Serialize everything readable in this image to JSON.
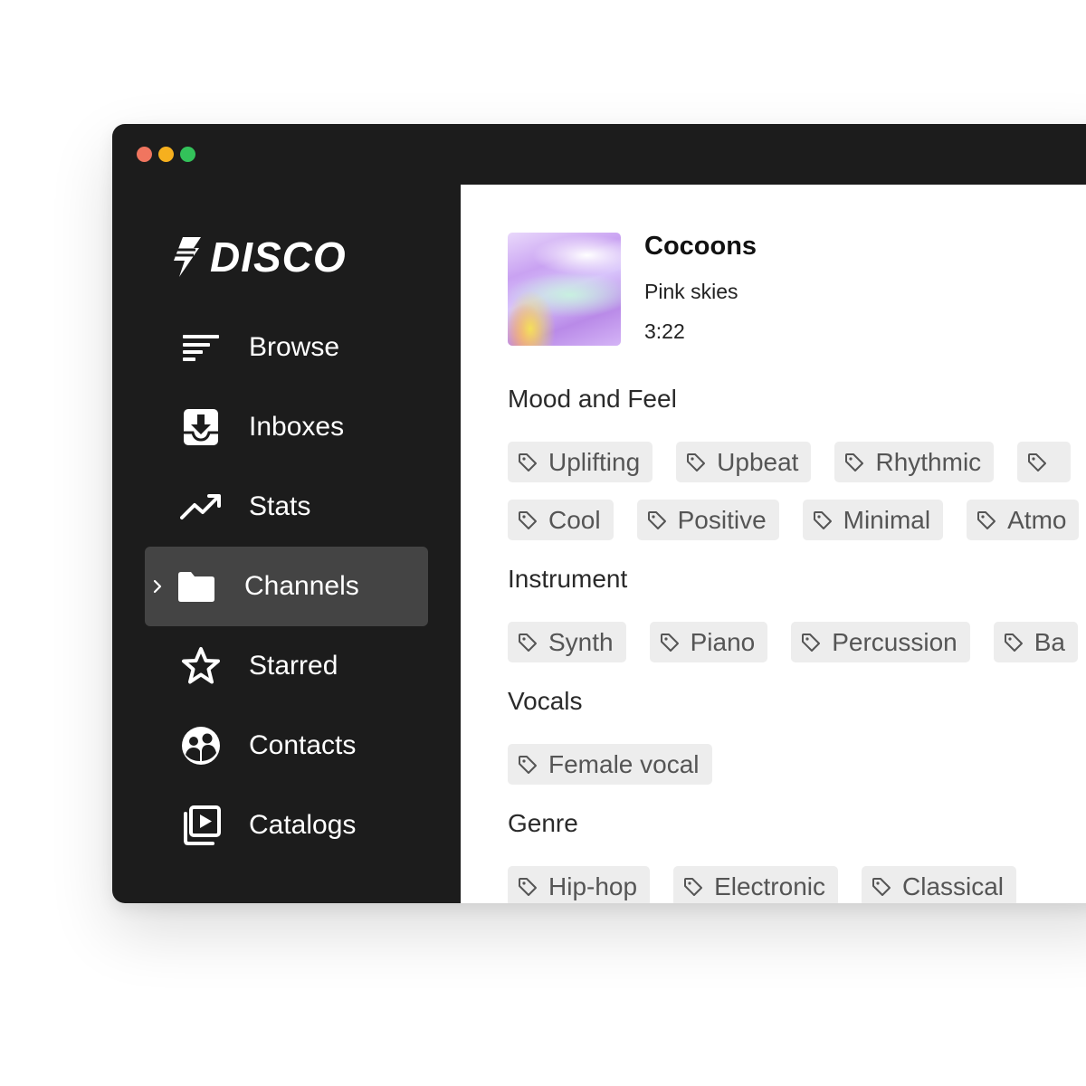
{
  "window": {
    "controls": [
      "close",
      "minimize",
      "maximize"
    ]
  },
  "brand": {
    "name": "DISCO",
    "icon": "lightning-bolt-icon"
  },
  "sidebar": {
    "items": [
      {
        "label": "Browse",
        "icon": "browse-lines-icon",
        "active": false
      },
      {
        "label": "Inboxes",
        "icon": "inbox-download-icon",
        "active": false
      },
      {
        "label": "Stats",
        "icon": "trend-up-icon",
        "active": false
      },
      {
        "label": "Channels",
        "icon": "folder-icon",
        "active": true
      },
      {
        "label": "Starred",
        "icon": "star-icon",
        "active": false
      },
      {
        "label": "Contacts",
        "icon": "contacts-group-icon",
        "active": false
      },
      {
        "label": "Catalogs",
        "icon": "catalog-play-icon",
        "active": false
      }
    ]
  },
  "track": {
    "title": "Cocoons",
    "artist": "Pink skies",
    "duration": "3:22"
  },
  "sections": {
    "mood": {
      "title": "Mood and Feel",
      "row1": [
        "Uplifting",
        "Upbeat",
        "Rhythmic",
        ""
      ],
      "row2": [
        "Cool",
        "Positive",
        "Minimal",
        "Atmo"
      ]
    },
    "instrument": {
      "title": "Instrument",
      "tags": [
        "Synth",
        "Piano",
        "Percussion",
        "Ba"
      ]
    },
    "vocals": {
      "title": "Vocals",
      "tags": [
        "Female vocal"
      ]
    },
    "genre": {
      "title": "Genre",
      "tags": [
        "Hip-hop",
        "Electronic",
        "Classical"
      ]
    }
  },
  "colors": {
    "sidebar_bg": "#1c1c1c",
    "active_item_bg": "#444444",
    "tag_bg": "#ededed",
    "close": "#f0755f",
    "minimize": "#f6b01e",
    "maximize": "#33c25a"
  }
}
